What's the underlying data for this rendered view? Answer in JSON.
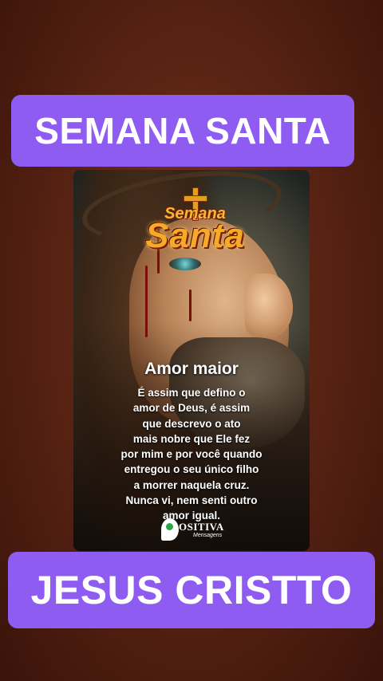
{
  "banners": {
    "top": "SEMANA SANTA",
    "bottom": "JESUS CRISTTO"
  },
  "card": {
    "logo": {
      "small": "Semana",
      "big": "Santa"
    },
    "title": "Amor maior",
    "lines": [
      "É assim que defino o",
      "amor de Deus, é assim",
      "que descrevo o ato",
      "mais nobre que Ele fez",
      "por mim e por você quando",
      "entregou o seu único filho",
      "a morrer naquela cruz.",
      "Nunca vi, nem senti outro",
      "amor igual."
    ],
    "brand": {
      "name": "OSITIVA",
      "sub": "Mensagens"
    }
  },
  "colors": {
    "banner": "#8e5cf0",
    "background": "#5a2414"
  }
}
